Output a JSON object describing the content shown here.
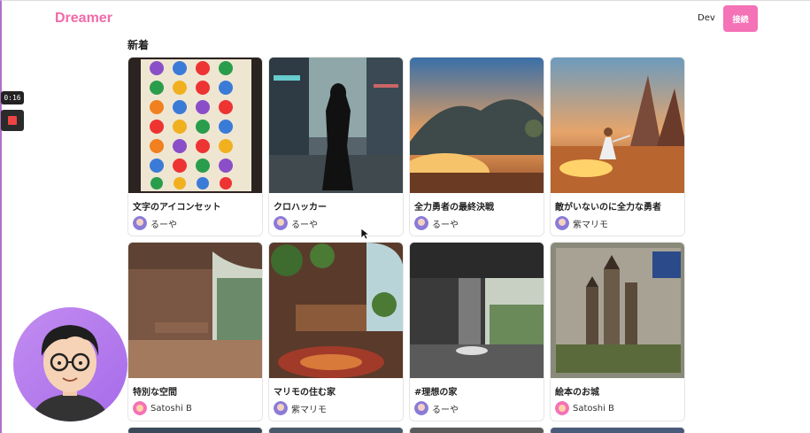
{
  "header": {
    "logo": "Dreamer",
    "nav_dev": "Dev",
    "connect_label": "接続"
  },
  "section_title": "新着",
  "recorder": {
    "timer": "0:16"
  },
  "cards": [
    {
      "title": "文字のアイコンセット",
      "author": "るーや",
      "avatar_color": "#8b7bd8"
    },
    {
      "title": "クロハッカー",
      "author": "るーや",
      "avatar_color": "#8b7bd8"
    },
    {
      "title": "全力勇者の最終決戦",
      "author": "るーや",
      "avatar_color": "#8b7bd8"
    },
    {
      "title": "敵がいないのに全力な勇者",
      "author": "紫マリモ",
      "avatar_color": "#8b7bd8"
    },
    {
      "title": "特別な空間",
      "author": "Satoshi B",
      "avatar_color": "#f472b6"
    },
    {
      "title": "マリモの住む家",
      "author": "紫マリモ",
      "avatar_color": "#8b7bd8"
    },
    {
      "title": "#理想の家",
      "author": "るーや",
      "avatar_color": "#8b7bd8"
    },
    {
      "title": "絵本のお城",
      "author": "Satoshi B",
      "avatar_color": "#f472b6"
    }
  ],
  "colors": {
    "brand": "#f26aa8",
    "button": "#f472b6"
  }
}
